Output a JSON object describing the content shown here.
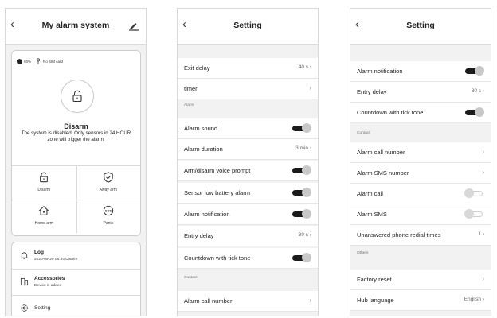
{
  "screen1": {
    "title": "My alarm system",
    "battery": "60%",
    "sim": "No SIM card",
    "mode": "Disarm",
    "description": "The system is disabled. Only sensors in 24 HOUR zone will trigger the alarm.",
    "actions": [
      {
        "label": "Disarm",
        "icon": "unlock-icon"
      },
      {
        "label": "Away arm",
        "icon": "shield-check-icon"
      },
      {
        "label": "Home arm",
        "icon": "home-icon"
      },
      {
        "label": "Panic",
        "icon": "sos-icon"
      }
    ],
    "log": {
      "title": "Log",
      "detail": "2020-09-29 08:34 Disarm"
    },
    "accessories": {
      "title": "Accessories",
      "detail": "Device is added"
    },
    "setting": {
      "title": "Setting"
    }
  },
  "screen2": {
    "title": "Setting",
    "rows": [
      {
        "label": "Exit delay",
        "value": "40 s"
      },
      {
        "label": "timer"
      }
    ],
    "section_alarm": "Alarm",
    "alarm_rows": [
      {
        "label": "Alarm sound",
        "toggle": true
      },
      {
        "label": "Alarm duration",
        "value": "3 min"
      },
      {
        "label": "Arm/disarm voice prompt",
        "toggle": true
      },
      {
        "label": "Sensor low battery alarm",
        "toggle": true
      },
      {
        "label": "Alarm notification",
        "toggle": true
      },
      {
        "label": "Entry delay",
        "value": "30 s"
      },
      {
        "label": "Countdown with tick tone",
        "toggle": true
      }
    ],
    "section_contact": "Contact",
    "contact_rows": [
      {
        "label": "Alarm call number"
      }
    ]
  },
  "screen3": {
    "title": "Setting",
    "top_rows": [
      {
        "label": "Alarm notification",
        "toggle": true
      },
      {
        "label": "Entry delay",
        "value": "30 s"
      },
      {
        "label": "Countdown with tick tone",
        "toggle": true
      }
    ],
    "section_contact": "Contact",
    "contact_rows": [
      {
        "label": "Alarm call number"
      },
      {
        "label": "Alarm SMS number"
      },
      {
        "label": "Alarm call",
        "toggle": false
      },
      {
        "label": "Alarm SMS",
        "toggle": false
      },
      {
        "label": "Unanswered phone redial times",
        "value": "1"
      }
    ],
    "section_others": "Others",
    "other_rows": [
      {
        "label": "Factory reset"
      },
      {
        "label": "Hub language",
        "value": "English"
      }
    ]
  }
}
